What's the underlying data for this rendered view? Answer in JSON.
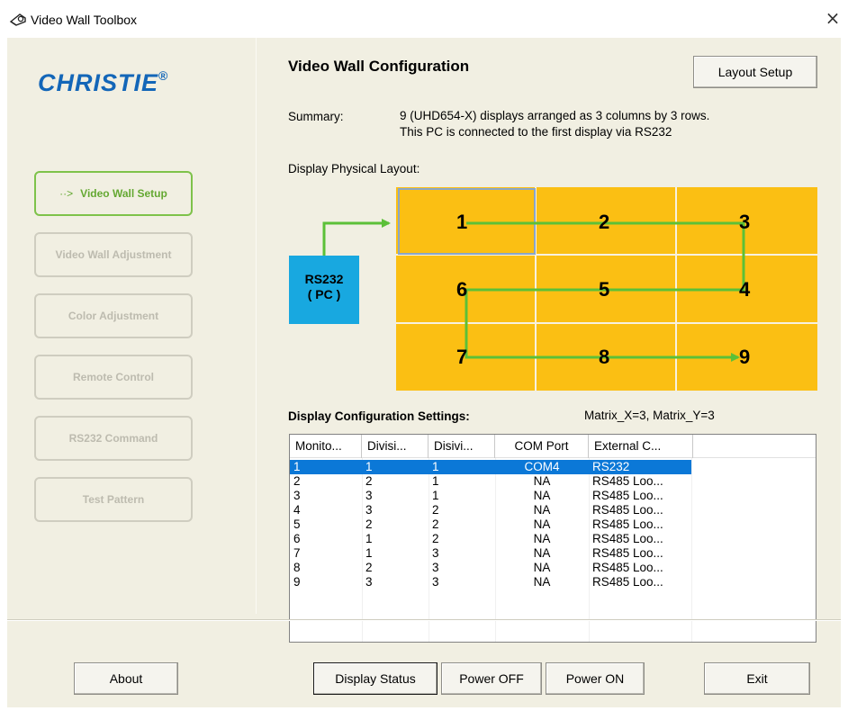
{
  "window": {
    "title": "Video Wall Toolbox",
    "close_glyph": "×",
    "app_icon": "projector-icon"
  },
  "logo": {
    "text": "CHRISTIE",
    "registered": "®",
    "color": "#1366b8"
  },
  "sidebar": {
    "items": [
      {
        "label": "Video Wall Setup",
        "state": "active",
        "arrow": "··>"
      },
      {
        "label": "Video Wall Adjustment",
        "state": "disabled"
      },
      {
        "label": "Color Adjustment",
        "state": "disabled"
      },
      {
        "label": "Remote Control",
        "state": "disabled"
      },
      {
        "label": "RS232 Command",
        "state": "disabled"
      },
      {
        "label": "Test Pattern",
        "state": "disabled"
      }
    ]
  },
  "main": {
    "title": "Video Wall Configuration",
    "layout_setup_button": "Layout Setup",
    "summary_label": "Summary:",
    "summary_line1": "9 (UHD654-X) displays arranged as 3 columns by 3 rows.",
    "summary_line2": "This PC is connected to the first display via RS232",
    "physical_layout_label": "Display Physical Layout:",
    "rs232_line1": "RS232",
    "rs232_line2": "( PC )",
    "grid_numbers": [
      "1",
      "2",
      "3",
      "6",
      "5",
      "4",
      "7",
      "8",
      "9"
    ],
    "config_label": "Display Configuration Settings:",
    "matrix_label": "Matrix_X=3, Matrix_Y=3",
    "colors": {
      "cell_fill": "#fbbf13",
      "path_arrow": "#5cc038",
      "rs232_fill": "#18a8e0",
      "selection": "#0b78d7"
    }
  },
  "table": {
    "columns": [
      "Monito...",
      "Divisi...",
      "Disivi...",
      "COM Port",
      "External C..."
    ],
    "rows": [
      [
        "1",
        "1",
        "1",
        "COM4",
        "RS232"
      ],
      [
        "2",
        "2",
        "1",
        "NA",
        "RS485 Loo..."
      ],
      [
        "3",
        "3",
        "1",
        "NA",
        "RS485 Loo..."
      ],
      [
        "4",
        "3",
        "2",
        "NA",
        "RS485 Loo..."
      ],
      [
        "5",
        "2",
        "2",
        "NA",
        "RS485 Loo..."
      ],
      [
        "6",
        "1",
        "2",
        "NA",
        "RS485 Loo..."
      ],
      [
        "7",
        "1",
        "3",
        "NA",
        "RS485 Loo..."
      ],
      [
        "8",
        "2",
        "3",
        "NA",
        "RS485 Loo..."
      ],
      [
        "9",
        "3",
        "3",
        "NA",
        "RS485 Loo..."
      ]
    ],
    "selected_row": 0
  },
  "footer": {
    "about": "About",
    "display_status": "Display Status",
    "power_off": "Power OFF",
    "power_on": "Power ON",
    "exit": "Exit"
  }
}
